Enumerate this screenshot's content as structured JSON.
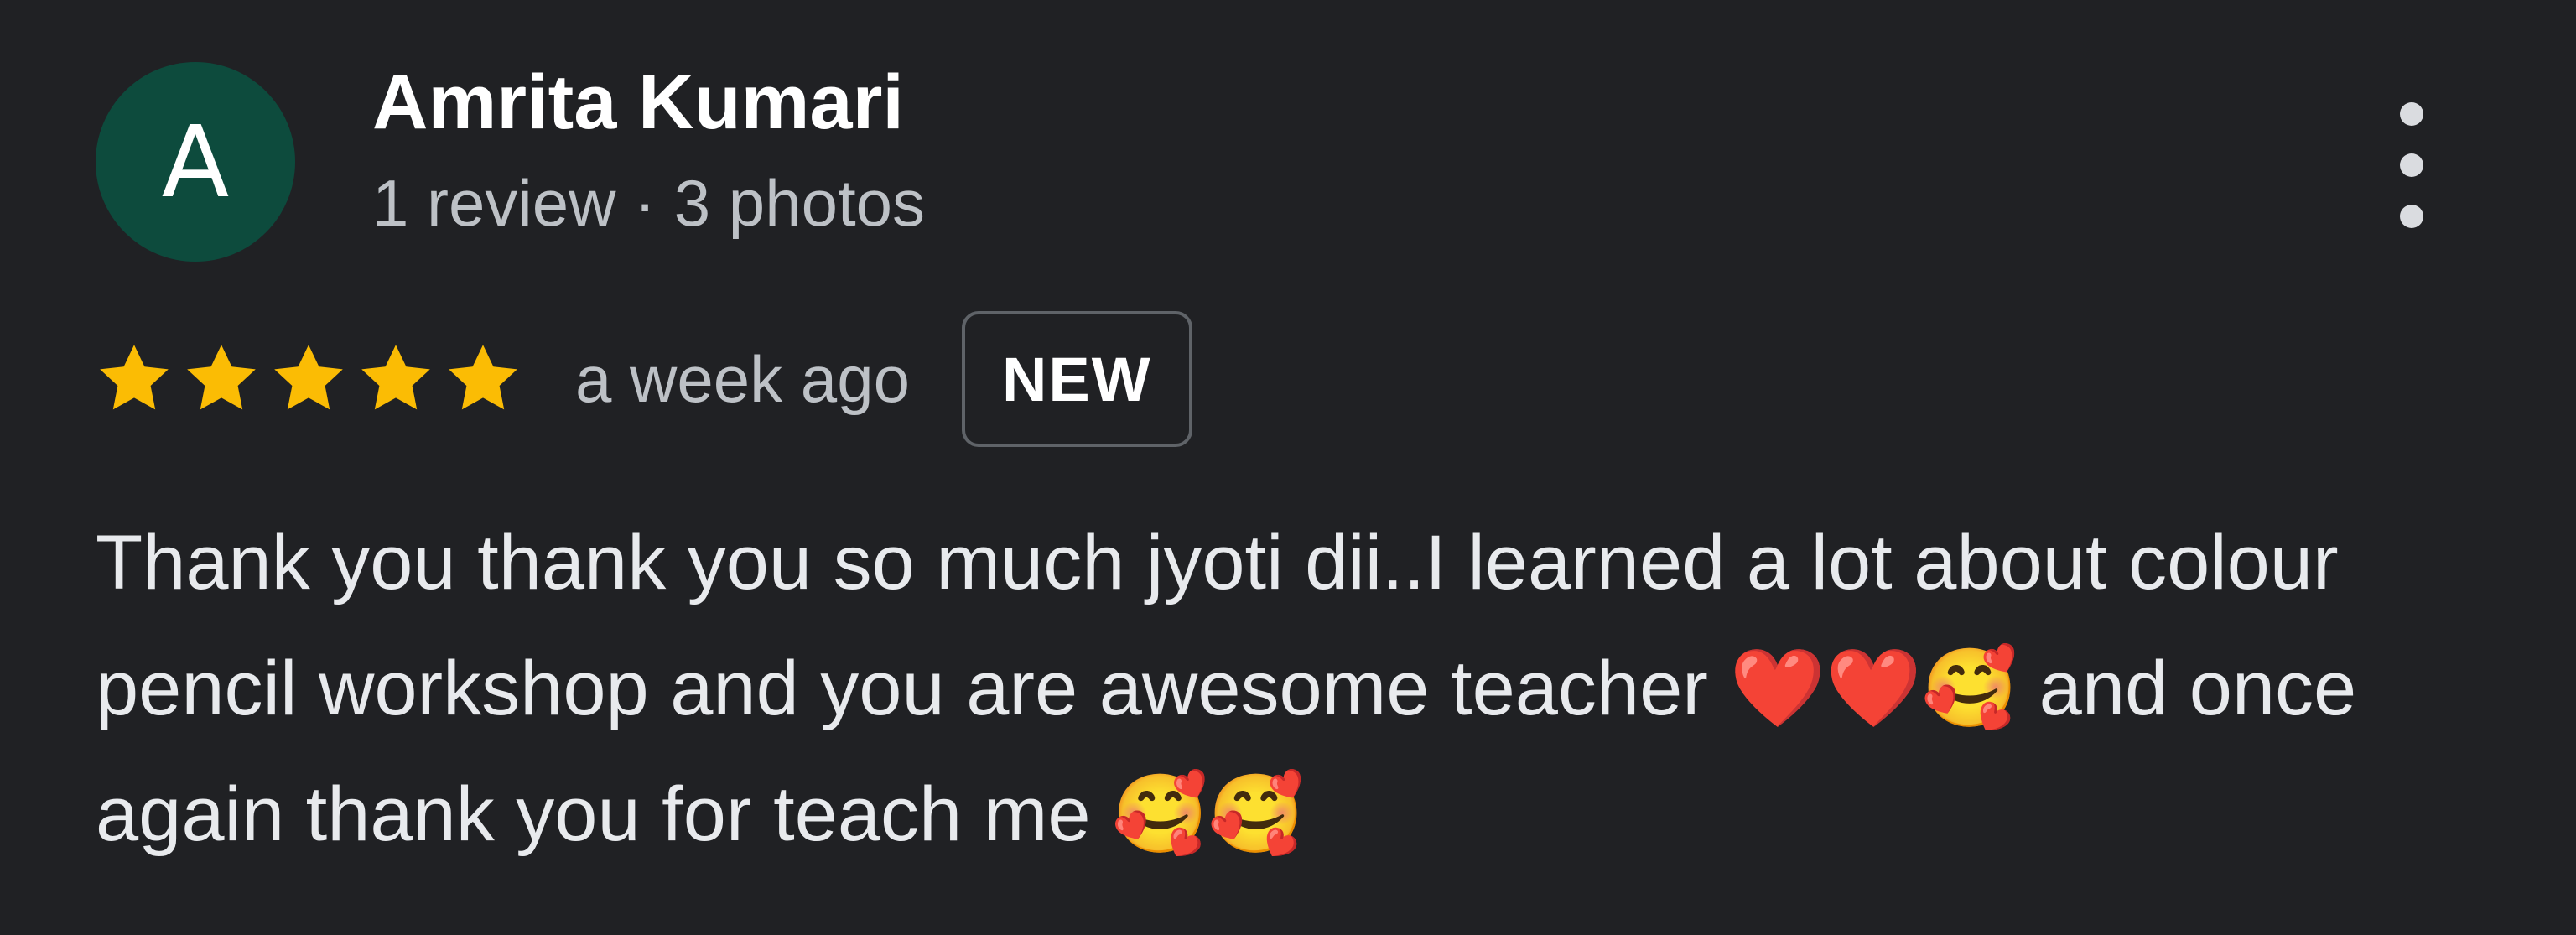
{
  "reviewer": {
    "avatar_initial": "A",
    "avatar_color": "#0d4b3d",
    "name": "Amrita Kumari",
    "meta": "1 review · 3 photos"
  },
  "menu": {
    "icon": "more-vertical-icon"
  },
  "rating": {
    "stars": 5,
    "max_stars": 5,
    "star_color": "#fbbc04",
    "date": "a week ago",
    "badge": "NEW"
  },
  "review": {
    "text": "Thank you thank you so much jyoti dii..I learned a lot about colour pencil workshop and you are awesome teacher ❤️❤️🥰 and once again thank you for teach me 🥰🥰"
  }
}
